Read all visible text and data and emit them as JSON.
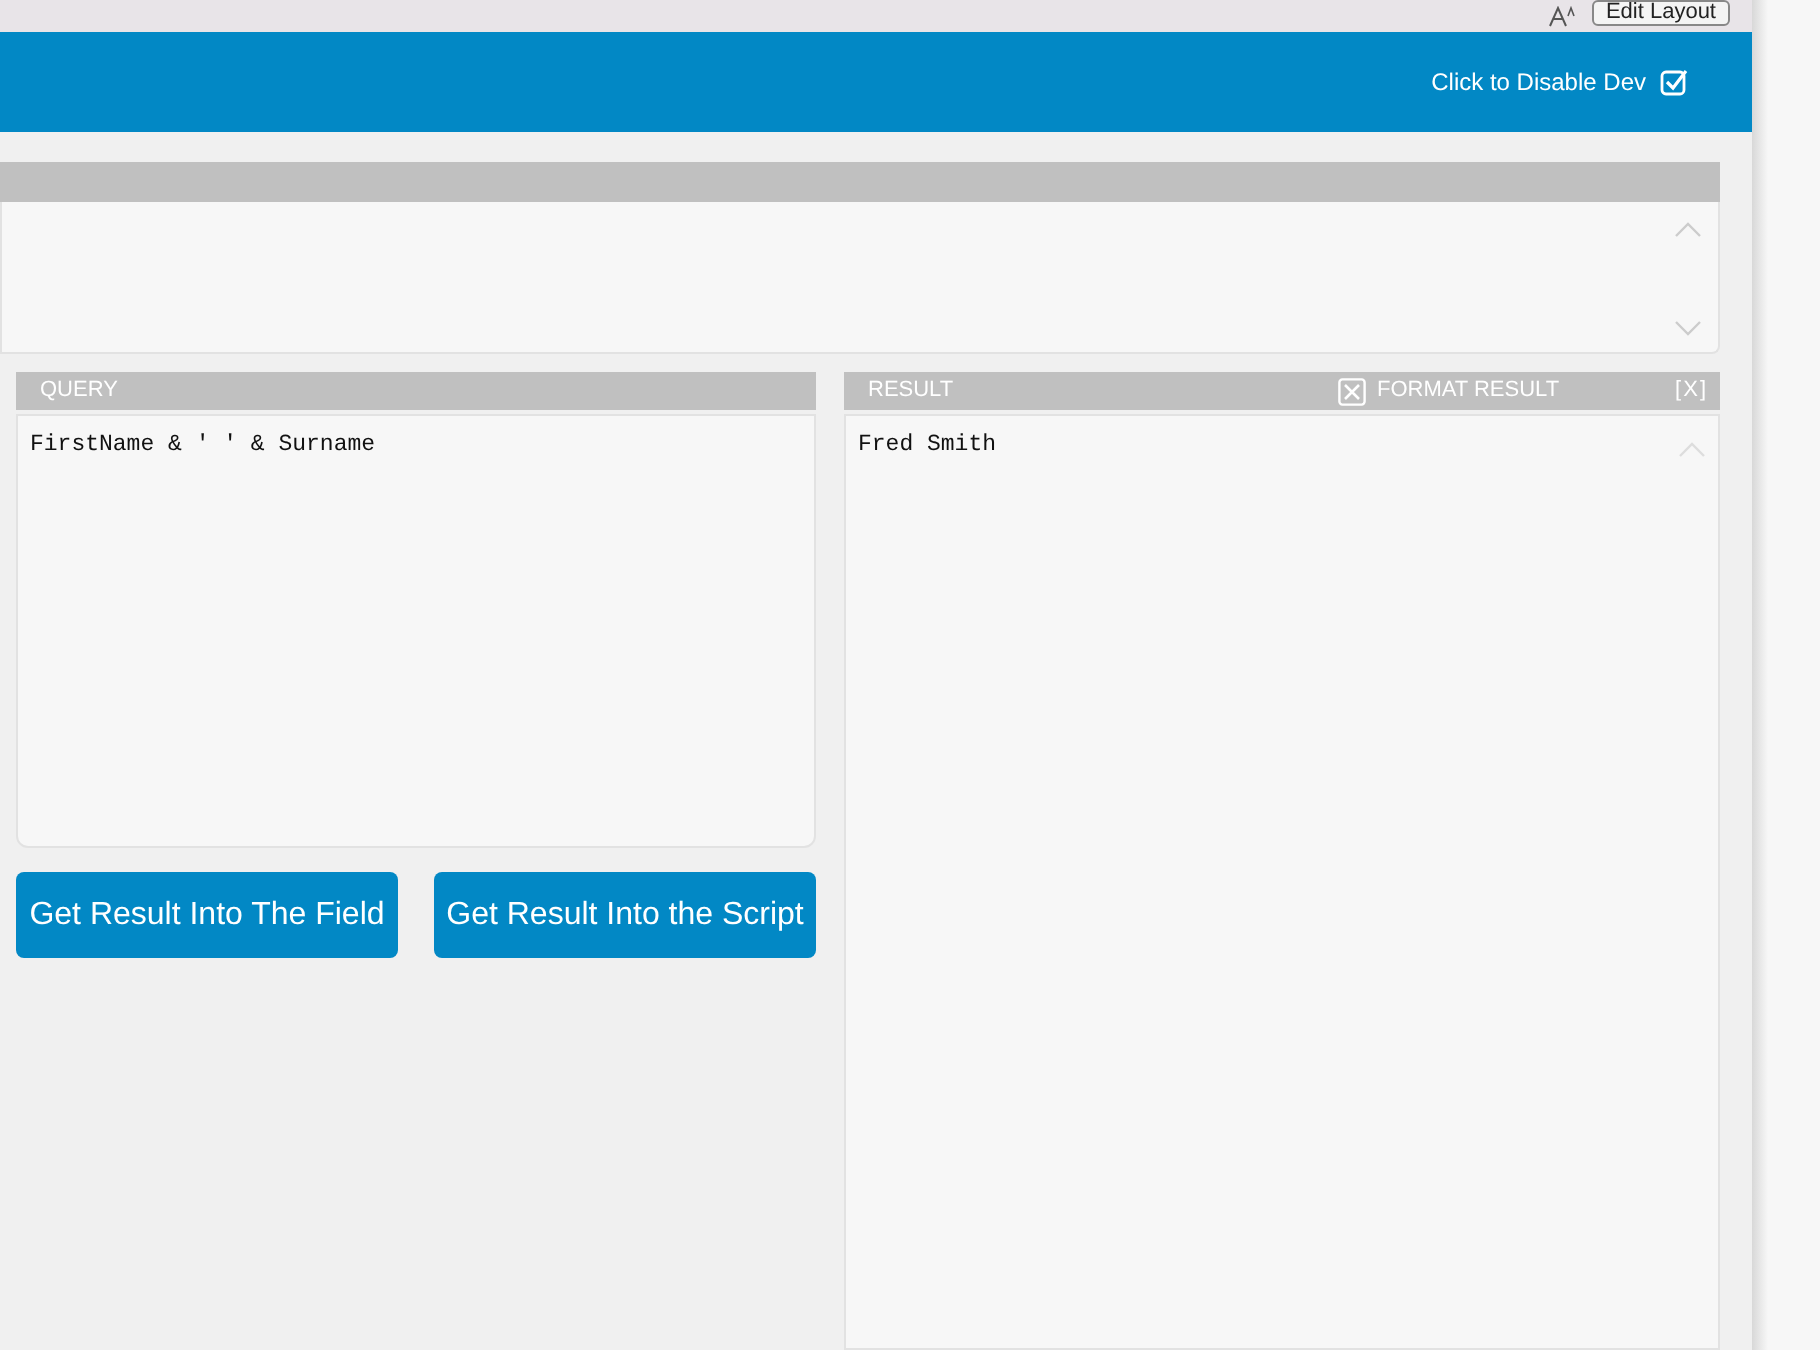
{
  "toolbar": {
    "edit_layout_button": "Edit Layout"
  },
  "header": {
    "dev_toggle": {
      "label": "Click to Disable Dev",
      "checked": true
    }
  },
  "query": {
    "title": "QUERY",
    "value": "FirstName & ' ' & Surname"
  },
  "result": {
    "title": "RESULT",
    "format_result": {
      "label": "FORMAT RESULT",
      "checked": true
    },
    "close": "[X]",
    "value": "Fred Smith"
  },
  "buttons": [
    "Get Result Into The Field",
    "Get Result Into the Script"
  ]
}
